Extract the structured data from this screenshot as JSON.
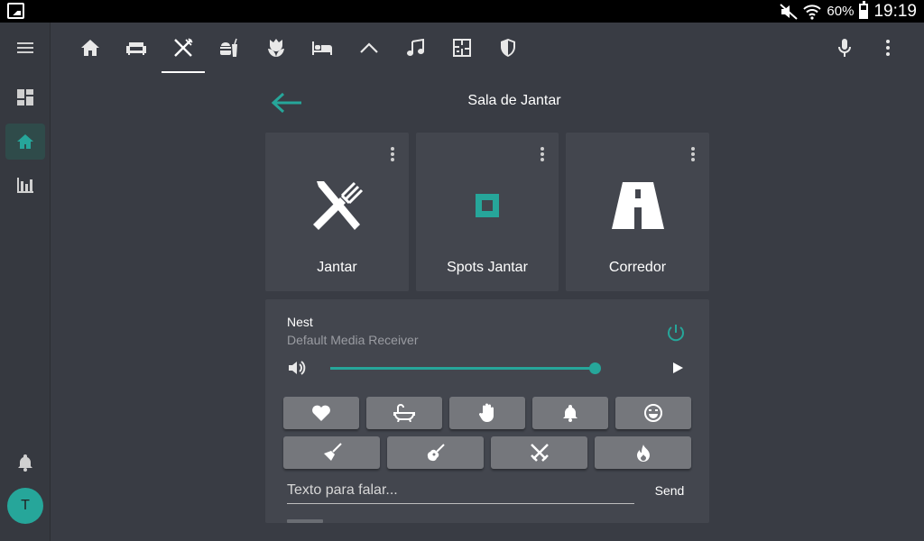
{
  "status_bar": {
    "battery_pct": "60%",
    "battery_level": 0.6,
    "time": "19:19",
    "icons": [
      "gallery-icon",
      "mute-icon",
      "wifi-icon",
      "battery-icon"
    ]
  },
  "sidebar": {
    "items": [
      {
        "name": "menu",
        "icon": "menu-icon"
      },
      {
        "name": "overview",
        "icon": "dashboard-icon"
      },
      {
        "name": "home",
        "icon": "home-icon",
        "active": true
      },
      {
        "name": "history",
        "icon": "bar-chart-icon"
      },
      {
        "name": "notifications",
        "icon": "bell-icon"
      }
    ],
    "avatar_initial": "T"
  },
  "topbar": {
    "tabs": [
      {
        "icon": "home-icon"
      },
      {
        "icon": "sofa-icon"
      },
      {
        "icon": "cutlery-icon",
        "active": true
      },
      {
        "icon": "food-drink-icon"
      },
      {
        "icon": "flower-icon"
      },
      {
        "icon": "bed-icon"
      },
      {
        "icon": "roof-icon"
      },
      {
        "icon": "music-icon"
      },
      {
        "icon": "floor-plan-icon"
      },
      {
        "icon": "shield-icon"
      }
    ],
    "actions": [
      "microphone-icon",
      "more-vertical-icon"
    ]
  },
  "page": {
    "title": "Sala de Jantar"
  },
  "cards": [
    {
      "label": "Jantar",
      "icon": "cutlery-icon",
      "icon_color": "#ffffff"
    },
    {
      "label": "Spots Jantar",
      "icon": "square-light-icon",
      "icon_color": "#26a69a"
    },
    {
      "label": "Corredor",
      "icon": "road-icon",
      "icon_color": "#ffffff"
    }
  ],
  "media_player": {
    "name": "Nest",
    "source": "Default Media Receiver",
    "volume_level": 0.99,
    "buttons_row1": [
      "heart-icon",
      "bathtub-icon",
      "hand-icon",
      "bell-icon",
      "smile-icon"
    ],
    "buttons_row2": [
      "broom-icon",
      "guitar-icon",
      "swords-icon",
      "fire-icon"
    ],
    "tts_placeholder": "Texto para falar...",
    "send_label": "Send"
  },
  "colors": {
    "accent": "#26a69a",
    "background": "#393c44",
    "card": "#43464e",
    "button": "#75777c"
  }
}
